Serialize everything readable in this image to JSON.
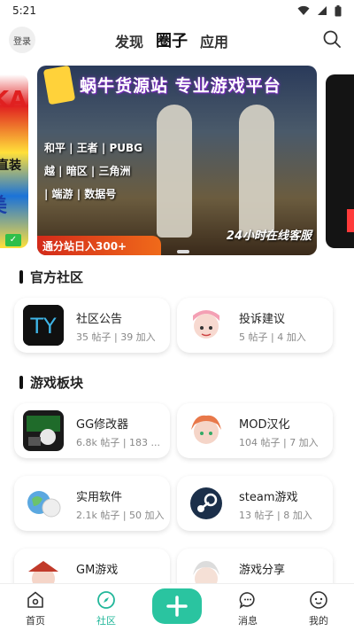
{
  "status": {
    "time": "5:21"
  },
  "header": {
    "login_label": "登录",
    "tabs": [
      {
        "label": "发现",
        "active": false
      },
      {
        "label": "圈子",
        "active": true
      },
      {
        "label": "应用",
        "active": false
      }
    ]
  },
  "banner": {
    "title": "蜗牛货源站 专业游戏平台",
    "games": [
      "和平 | 王者 | PUBG",
      "越 | 暗区 | 三角洲",
      "| 端游 | 数据号"
    ],
    "service": "24小时在线客服",
    "ribbon": "通分站日入300+",
    "side_left": {
      "big": "KA",
      "mid": "直装",
      "low": "美"
    }
  },
  "sections": {
    "official": {
      "title": "官方社区"
    },
    "games": {
      "title": "游戏板块"
    }
  },
  "official_cards": [
    {
      "name": "社区公告",
      "meta": "35 帖子 | 39 加入"
    },
    {
      "name": "投诉建议",
      "meta": "5 帖子 | 4 加入"
    }
  ],
  "game_cards": [
    {
      "name": "GG修改器",
      "meta": "6.8k 帖子 | 183 ..."
    },
    {
      "name": "MOD汉化",
      "meta": "104 帖子 | 7 加入"
    },
    {
      "name": "实用软件",
      "meta": "2.1k 帖子 | 50 加入"
    },
    {
      "name": "steam游戏",
      "meta": "13 帖子 | 8 加入"
    },
    {
      "name": "GM游戏",
      "meta": ""
    },
    {
      "name": "游戏分享",
      "meta": ""
    }
  ],
  "thumb_text": {
    "ty": "TY"
  },
  "bottom_nav": {
    "items": [
      {
        "label": "首页"
      },
      {
        "label": "社区"
      },
      {
        "label": "消息"
      },
      {
        "label": "我的"
      }
    ]
  },
  "colors": {
    "accent": "#2ac4a0",
    "active_nav": "#22b79a"
  }
}
